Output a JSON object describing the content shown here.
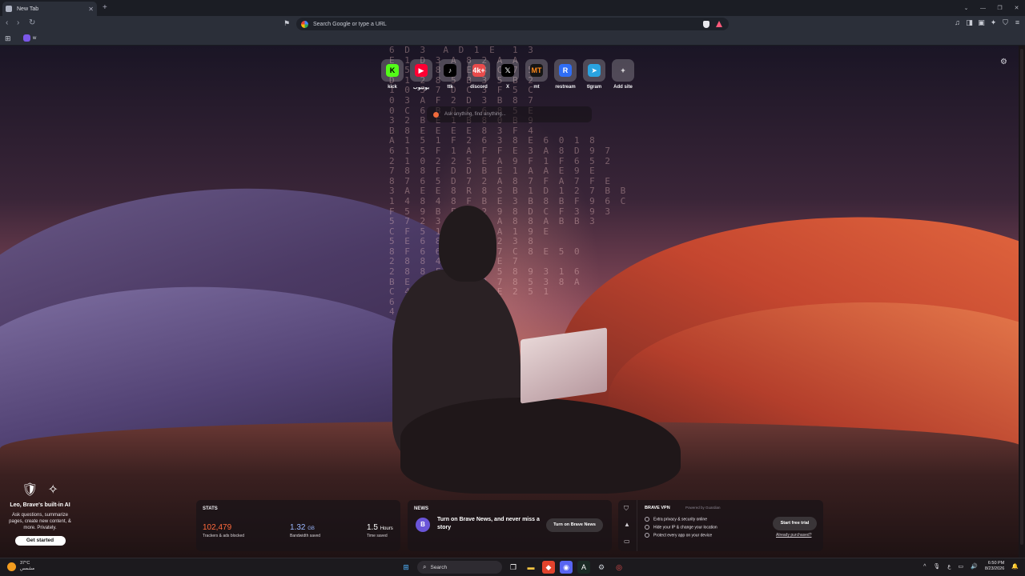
{
  "browser": {
    "tab_title": "New Tab",
    "new_tab_symbol": "+",
    "omnibox_placeholder": "Search Google or type a URL",
    "bookmark_item_label": "w"
  },
  "top_sites": [
    {
      "label": "kick",
      "glyph": "K",
      "color": "#53fc18",
      "fg": "#000000"
    },
    {
      "label": "يوتيوب",
      "glyph": "▶",
      "color": "#ff0033",
      "fg": "#ffffff"
    },
    {
      "label": "ttk",
      "glyph": "♪",
      "color": "#000000",
      "fg": "#ffffff"
    },
    {
      "label": "discord",
      "glyph": "4k+",
      "color": "#e94b4b",
      "fg": "#ffffff"
    },
    {
      "label": "X",
      "glyph": "𝕏",
      "color": "#000000",
      "fg": "#ffffff"
    },
    {
      "label": "mt",
      "glyph": "MT",
      "color": "#151515",
      "fg": "#ff8a1c"
    },
    {
      "label": "restream",
      "glyph": "R",
      "color": "#2f6df5",
      "fg": "#ffffff"
    },
    {
      "label": "tlgram",
      "glyph": "➤",
      "color": "#2aa3e0",
      "fg": "#ffffff"
    },
    {
      "label": "Add site",
      "glyph": "+",
      "color": "transparent",
      "fg": "#ffffff"
    }
  ],
  "ask_box": {
    "placeholder": "Ask anything, find anything..."
  },
  "background_matrix": "6 D 3  A D 1 E  1 3\nE 1 D 3 A 8 2 A A\nA 5 8 8 D E 3 C 7 5\nD 1 2 8 5 B 3 5 B 2\n1 0 3 7 D C 3 F 5 C\n0 3 A F 2 D 3 B 8 7\n0 C 6 B D C 6 8 5 E\n3 2 B E 1 B 8 0 B 9\nB 8 E E E E 8 3 F 4\nA 1 5 1 F 2 6 3 8 E 6 0 1 8\n6 1 5 F 1 A F F E 3 A 8 D 9 7\n2 1 0 2 2 5 E A 9 F 1 F 6 5 2\n7 8 8 F D D B E 1 A A E 9 E\n8 7 6 5 D 7 2 A 8 7 F A 7 F E\n3 A E E 8 R 8 S B 1 D 1 2 7 B B\n1 4 8 4 8 F B E 3 B 8 B F 9 6 C\nF 5 9 B E 4 2 9 8 D C F 3 9 3\n5 7 2 3 A 5 3 A 8 8 A B B 3\nC F 5 1 3 2 1 A 1 9 E\n5 E 6 8 C 3 8 2 3 8\n8 F 6 6 7 E 6 7 C 8 E 5 0\n2 8 8 4 7 7 1 E 7\n2 8 8 F 7 5 4 5 8 9 3 1 6\nB E 6 5 F 7 8 7 8 5 3 8 A\nC 4 8 7 0 0 4 E 2 5 1\n6 E 9 8 8 4\n4 D 5 9 E",
  "leo": {
    "title": "Leo, Brave's built-in AI",
    "description": "Ask questions, summarize pages, create new content, & more. Privately.",
    "button": "Get started"
  },
  "stats": {
    "label": "STATS",
    "trackers_value": "102,479",
    "trackers_caption": "Trackers & ads blocked",
    "bandwidth_value": "1.32",
    "bandwidth_unit": "GB",
    "bandwidth_caption": "Bandwidth saved",
    "time_value": "1.5",
    "time_unit": "Hours",
    "time_caption": "Time saved"
  },
  "news": {
    "label": "NEWS",
    "text": "Turn on Brave News, and never miss a story",
    "button": "Turn on Brave News"
  },
  "vpn": {
    "title": "BRAVE VPN",
    "powered": "Powered by Guardian",
    "features": [
      "Extra privacy & security online",
      "Hide your IP & change your location",
      "Protect every app on your device"
    ],
    "button": "Start free trial",
    "link": "Already purchased?"
  },
  "taskbar": {
    "temperature": "37°C",
    "weather_text": "مشمس",
    "search_placeholder": "Search",
    "language": "ع",
    "time": "6:50 PM",
    "date": "8/23/2026"
  }
}
